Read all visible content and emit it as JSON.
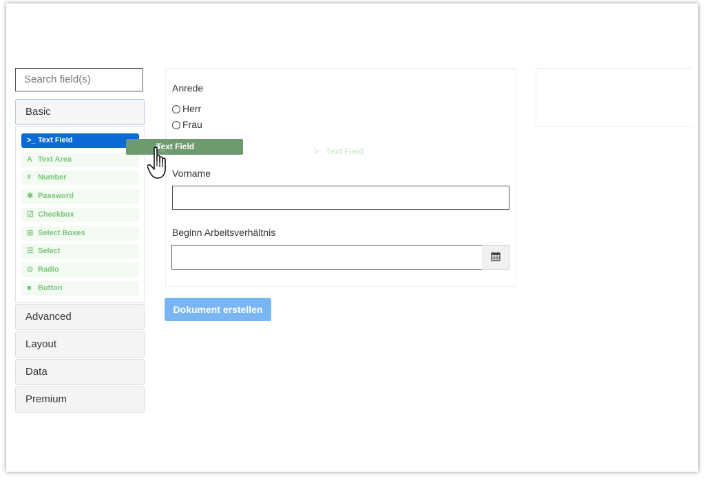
{
  "sidebar": {
    "search_placeholder": "Search field(s)",
    "groups": {
      "basic": "Basic",
      "advanced": "Advanced",
      "layout": "Layout",
      "data": "Data",
      "premium": "Premium"
    },
    "basic_items": [
      {
        "label": "Text Field",
        "icon": ">_"
      },
      {
        "label": "Text Area",
        "icon": "A"
      },
      {
        "label": "Number",
        "icon": "#"
      },
      {
        "label": "Password",
        "icon": "✱"
      },
      {
        "label": "Checkbox",
        "icon": "☑"
      },
      {
        "label": "Select Boxes",
        "icon": "⊞"
      },
      {
        "label": "Select",
        "icon": "☰"
      },
      {
        "label": "Radio",
        "icon": "⊙"
      },
      {
        "label": "Button",
        "icon": "■"
      }
    ]
  },
  "drag": {
    "label": "Text Field",
    "icon": ">_",
    "ghost_label": "Text Field"
  },
  "form": {
    "anrede_label": "Anrede",
    "radio_options": [
      "Herr",
      "Frau"
    ],
    "vorname_label": "Vorname",
    "beginn_label": "Beginn Arbeitsverhältnis",
    "submit_label": "Dokument erstellen"
  },
  "colors": {
    "active_item": "#0b6bd6",
    "item_text": "#7bc47b",
    "drag_bg": "#6e9a70",
    "submit_bg": "#79b5f2"
  }
}
